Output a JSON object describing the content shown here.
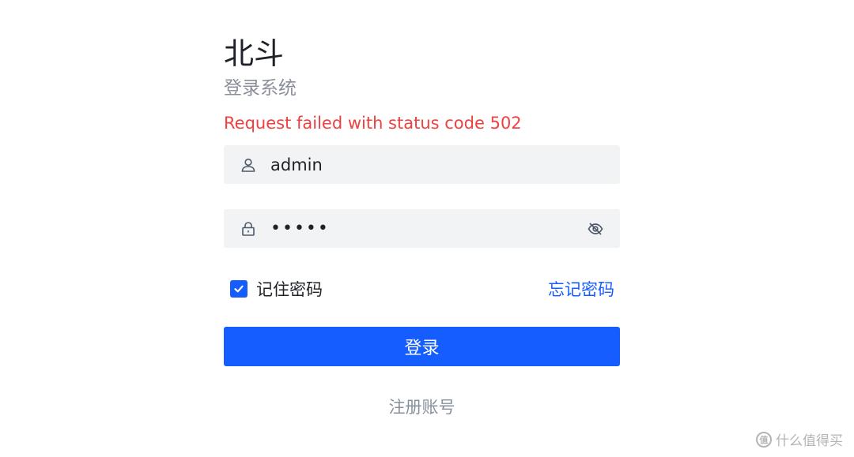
{
  "login": {
    "title": "北斗",
    "subtitle": "登录系统",
    "error_message": "Request failed with status code 502",
    "username": {
      "value": "admin",
      "icon": "user-icon"
    },
    "password": {
      "value": "•••••",
      "icon": "lock-icon",
      "toggle_icon": "eye-off-icon"
    },
    "remember_me": {
      "label": "记住密码",
      "checked": true
    },
    "forgot_password": "忘记密码",
    "submit_label": "登录",
    "register_link": "注册账号"
  },
  "watermark": {
    "badge": "值",
    "text": "什么值得买"
  },
  "colors": {
    "accent": "#165dff",
    "error": "#f04040",
    "field_bg": "#f2f3f5",
    "muted": "#86909c"
  }
}
